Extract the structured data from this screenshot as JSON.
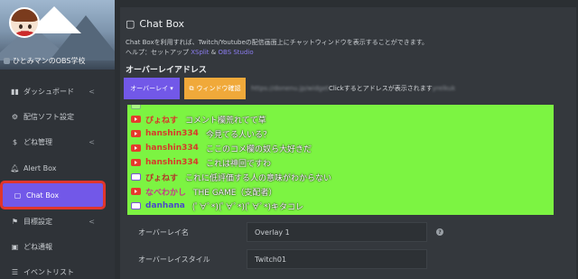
{
  "sidebar": {
    "profile_name": "ひとみマンのOBS学校",
    "items": [
      {
        "icon": "bar-chart-icon",
        "label": "ダッシュボード",
        "chevron": "<"
      },
      {
        "icon": "gear-icon",
        "label": "配信ソフト設定",
        "chevron": ""
      },
      {
        "icon": "dollar-icon",
        "label": "どね管理",
        "chevron": "<"
      },
      {
        "icon": "bell-icon",
        "label": "Alert Box",
        "chevron": ""
      },
      {
        "icon": "chat-icon",
        "label": "Chat Box",
        "chevron": ""
      },
      {
        "icon": "flag-icon",
        "label": "目標設定",
        "chevron": "<"
      },
      {
        "icon": "image-icon",
        "label": "どね通報",
        "chevron": ""
      },
      {
        "icon": "list-icon",
        "label": "イベントリスト",
        "chevron": ""
      }
    ],
    "active_index": 4
  },
  "main": {
    "title": "Chat Box",
    "description": "Chat Boxを利用すれば、Twitch/Youtubeの配信画面上にチャットウィンドウを表示することができます。",
    "help_prefix": "ヘルプ：セットアップ",
    "help_link1": "XSplit",
    "help_amp": "&",
    "help_link2": "OBS Studio",
    "section_overlay_address": "オーバーレイアドレス",
    "tab_overlay": "オーバーレイ ▾",
    "tab_window_check": "ウィンドウ確認",
    "url_blurred": "https://donenu.jp/widget",
    "url_hint": "Clickするとアドレスが表示されます",
    "url_blurred_tail": "yrelkuk"
  },
  "chat": {
    "bg_color": "#7cf442",
    "messages": [
      {
        "source": "youtube",
        "user": "ぴょねす",
        "user_color": "#d63a2a",
        "text": "コメント欄荒れてて草",
        "faded": false
      },
      {
        "source": "youtube",
        "user": "hanshin334",
        "user_color": "#d63a2a",
        "text": "今見てる人いる？",
        "faded": false
      },
      {
        "source": "youtube",
        "user": "hanshin334",
        "user_color": "#d63a2a",
        "text": "ここのコメ欄の奴ら大好きだ",
        "faded": false
      },
      {
        "source": "youtube",
        "user": "hanshin334",
        "user_color": "#d63a2a",
        "text": "これは神回ですわ",
        "faded": false
      },
      {
        "source": "twitch",
        "user": "ぴょねす",
        "user_color": "#b23a2a",
        "text": "これに低評価する人の意味がわからない",
        "faded": false
      },
      {
        "source": "youtube",
        "user": "なべわかし",
        "user_color": "#c43a8a",
        "text": "THE GAME（支配者）",
        "faded": false
      },
      {
        "source": "twitch",
        "user": "danhana",
        "user_color": "#4a4ac8",
        "text": "(ﾟ∀ﾟ*)(ﾟ∀ﾟ*)(ﾟ∀ﾟ*)キタコレ",
        "faded": false
      }
    ]
  },
  "form": {
    "overlay_name_label": "オーバーレイ名",
    "overlay_name_value": "Overlay 1",
    "overlay_style_label": "オーバーレイスタイル",
    "overlay_style_value": "Twitch01"
  }
}
